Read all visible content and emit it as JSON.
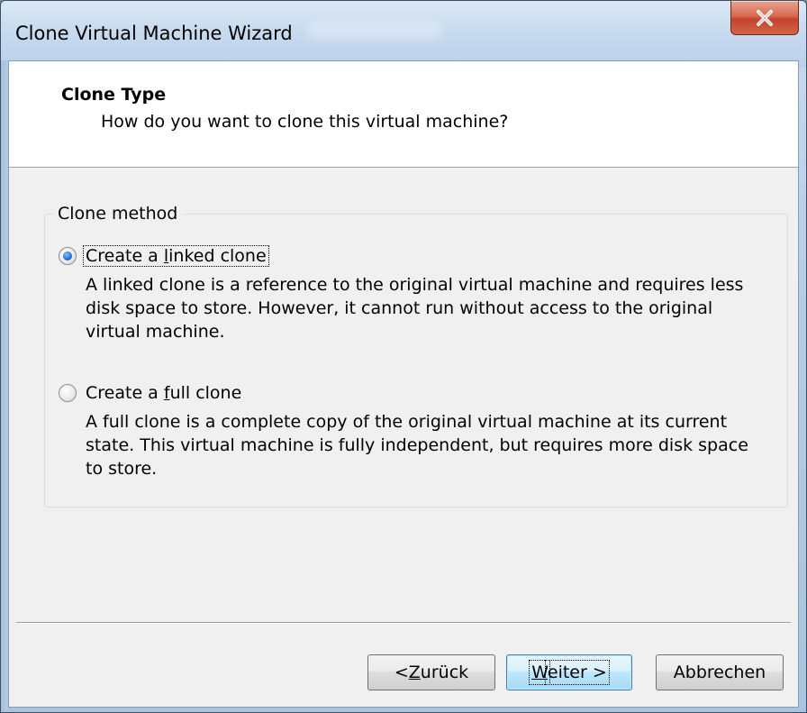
{
  "window": {
    "title": "Clone Virtual Machine Wizard"
  },
  "header": {
    "title": "Clone Type",
    "subtitle": "How do you want to clone this virtual machine?"
  },
  "group": {
    "label": "Clone method"
  },
  "options": [
    {
      "label_pre": "Create a ",
      "label_key": "l",
      "label_post": "inked clone",
      "checked": true,
      "description": "A linked clone is a reference to the original virtual machine and requires less disk space to store. However, it cannot run without access to the original virtual machine."
    },
    {
      "label_pre": "Create a ",
      "label_key": "f",
      "label_post": "ull clone",
      "checked": false,
      "description": "A full clone is a complete copy of the original virtual machine at its current state. This virtual machine is fully independent, but requires more disk space to store."
    }
  ],
  "buttons": {
    "back_pre": "< ",
    "back_key": "Z",
    "back_post": "urück",
    "next_key": "W",
    "next_post": "eiter >",
    "cancel": "Abbrechen"
  },
  "icons": {
    "close": "close-icon"
  },
  "colors": {
    "close_button": "#c2432a",
    "radio_selected": "#1d6ed8",
    "default_button_border": "#3c7fb1"
  }
}
